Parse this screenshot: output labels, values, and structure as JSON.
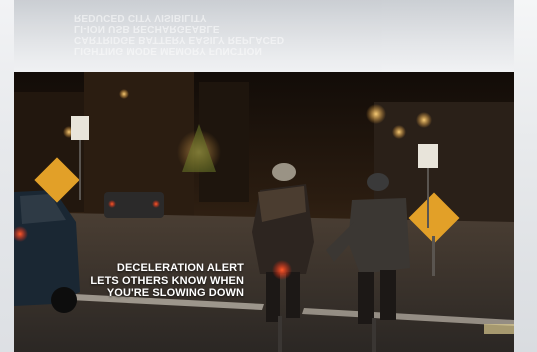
{
  "ghost_text": {
    "lines": [
      "Lighting mode memory function",
      "Cartridge battery easily replaced",
      "Li-ion USB rechargeable",
      "Reduced City Visibility"
    ]
  },
  "caption": {
    "lines": [
      "Deceleration alert",
      "lets others know when",
      "you're slowing down"
    ]
  },
  "colors": {
    "night_sky": "#1b130d",
    "street_glow": "#c8872f",
    "sign_yellow": "#e2a028",
    "tail_red": "#ff3a1a",
    "caption_text": "#ffffff"
  }
}
